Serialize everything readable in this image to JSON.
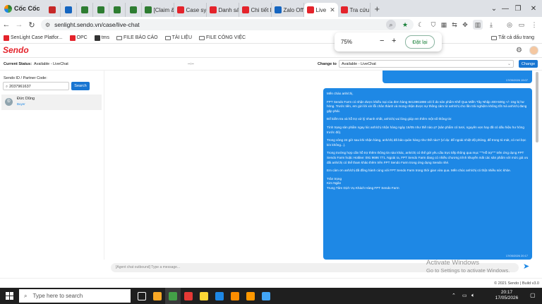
{
  "browser": {
    "brand_name": "Cốc Cốc",
    "tabs": [
      {
        "title": "",
        "favicon_color": "#c62828"
      },
      {
        "title": "",
        "favicon_color": "#1565c0"
      },
      {
        "title": "",
        "favicon_color": "#2e7d32"
      },
      {
        "title": "",
        "favicon_color": "#2e7d32"
      },
      {
        "title": "",
        "favicon_color": "#2e7d32"
      },
      {
        "title": "",
        "favicon_color": "#2e7d32"
      },
      {
        "title": "[Claim &",
        "favicon_color": "#2e7d32"
      },
      {
        "title": "Case sys",
        "favicon_color": "#e4232b"
      },
      {
        "title": "Danh sác",
        "favicon_color": "#e4232b"
      },
      {
        "title": "Chi tiết k",
        "favicon_color": "#e4232b"
      },
      {
        "title": "Zalo Offi",
        "favicon_color": "#1565c0"
      },
      {
        "title": "Live",
        "favicon_color": "#e4232b"
      },
      {
        "title": "Tra cứu t",
        "favicon_color": "#e4232b"
      }
    ],
    "url": "senlight.sendo.vn/case/live-chat",
    "bookmarks": [
      {
        "label": "SenLight Case Platfor...",
        "color": "#e4232b"
      },
      {
        "label": "OPC",
        "color": "#e4232b"
      },
      {
        "label": "tms",
        "color": "#333333"
      },
      {
        "label": "FILE BÁO CÁO",
        "color": "folder"
      },
      {
        "label": "TÀI LIỆU",
        "color": "folder"
      },
      {
        "label": "FILE CÔNG VIỆC",
        "color": "folder"
      }
    ],
    "all_bookmarks": "Tất cả dấu trang",
    "zoom": {
      "level": "75%",
      "minus": "−",
      "plus": "+",
      "reset": "Đặt lại"
    }
  },
  "app": {
    "logo": "Sendo",
    "current_status_label": "Current Status:",
    "current_status_value": "Available - LiveChat",
    "timer": "--:--",
    "change_to_label": "Change to",
    "change_to_value": "Available - LiveChat",
    "change_button": "Change",
    "search_label": "Sendo ID / Partner Code:",
    "search_value": "2037961637",
    "search_button": "Search",
    "contact": {
      "initial": "Đ",
      "name": "Đức Dũng",
      "state": "Buyer"
    },
    "prev_timestamp": "17/05/2026 19:07",
    "message_paragraphs": [
      "Mến chào anh/chị,",
      "FPT Sendo Farm có nhận được khiếu nại của đơn hàng 8413961886 với lí do sản phẩm Khế Qua Miền Tây Nhập 400-500g +/- 15g bị hư hỏng. Trước tiên, em gửi lời xin lỗi chân thành và mong nhận được sự thông cảm từ anh/chị cho lần trải nghiệm không tốt mà anh/chị đang gặp phải.",
      "Để kiểm tra và hỗ trợ xử lý nhanh nhất, anh/chị vui lòng giúp em thêm một số thông tin:",
      "Tình trạng sản phẩm ngay lúc anh/chị nhận hàng ngày 16/05 như thế nào ạ? (sản phẩm có tươi, nguyên vẹn hay đã có dấu hiệu hư hỏng trước đó).",
      "Trong vòng 24 giờ sau khi nhận hàng, anh/chị đã bảo quản hàng như thế nào? (ví dụ: để ngoài nhiệt độ phòng, để trong tủ mát, có nơi bọc kín không...).",
      "Trong trường hợp cần hỗ trợ thêm thông tin nào khác, anh/chị có thể gửi yêu cầu trực tiếp thông qua mục \"\"\"Hỗ trợ\"\"\" trên ứng dụng FPT Sendo Farm hoặc Hotline: 091 9696 771. Ngoài ra, FPT Sendo Farm đang có nhiều chương trình khuyến mãi các sản phẩm với mức giá ưu đãi anh/chị có thể tham khảo thêm trên FPT Sendo Farm trong ứng dụng Sendo nhé.",
      "Em cảm ơn anh/chị đã đồng hành cùng với FPT Sendo Farm trong thời gian vừa qua. Mến chúc anh/chị có thật nhiều sức khỏe.",
      "Trân trọng\nKim Ngân\nTrung Tâm Dịch Vụ Khách Hàng FPT Sendo Farm"
    ],
    "message_timestamp": "17/05/2026 20:17",
    "composer_placeholder": "[Agent chat outbound] Type a message...",
    "footer": "© 2021 Sendo | Build v3.0"
  },
  "watermark": {
    "line1": "Activate Windows",
    "line2": "Go to Settings to activate Windows."
  },
  "taskbar": {
    "search_placeholder": "Type here to search",
    "time": "20:17",
    "date": "17/05/2026",
    "icons": [
      {
        "name": "task-view",
        "color": "#ffffff"
      },
      {
        "name": "file-explorer",
        "color": "#f9a825"
      },
      {
        "name": "coccoc",
        "color": "#43a047"
      },
      {
        "name": "wps",
        "color": "#e53935"
      },
      {
        "name": "sticky-notes",
        "color": "#fdd835"
      },
      {
        "name": "zalo",
        "color": "#1e88e5"
      },
      {
        "name": "chrome",
        "color": "#fb8c00"
      },
      {
        "name": "sublime",
        "color": "#ff9800"
      },
      {
        "name": "extra-app",
        "color": "#42a5f5"
      }
    ]
  }
}
